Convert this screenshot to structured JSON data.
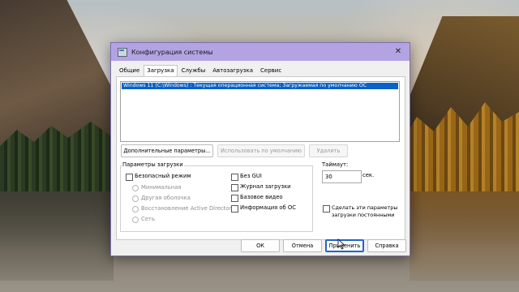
{
  "window": {
    "title": "Конфигурация системы",
    "close_glyph": "✕",
    "app_icon": "system-config-icon"
  },
  "tabs": [
    {
      "label": "Общие",
      "active": false
    },
    {
      "label": "Загрузка",
      "active": true
    },
    {
      "label": "Службы",
      "active": false
    },
    {
      "label": "Автозагрузка",
      "active": false
    },
    {
      "label": "Сервис",
      "active": false
    }
  ],
  "boot_list": {
    "items": [
      "Windows 11 (C:\\Windows) : Текущая операционная система; Загружаемая по умолчанию ОС"
    ]
  },
  "boot_buttons": {
    "advanced": "Дополнительные параметры...",
    "set_default": "Использовать по умолчанию",
    "delete": "Удалить"
  },
  "boot_options": {
    "title": "Параметры загрузки",
    "safe_boot": "Безопасный режим",
    "minimal": "Минимальная",
    "alt_shell": "Другая оболочка",
    "ad_repair": "Восстановление Active Directory",
    "network": "Сеть",
    "no_gui": "Без GUI",
    "boot_log": "Журнал загрузки",
    "base_video": "Базовое видео",
    "os_info": "Информация  об ОС"
  },
  "timeout": {
    "label": "Таймаут:",
    "value": "30",
    "unit": "сек."
  },
  "permanent": {
    "line1": "Сделать эти параметры",
    "line2": "загрузки постоянными"
  },
  "footer": {
    "ok": "ОК",
    "cancel": "Отмена",
    "apply": "Применить",
    "help": "Справка"
  },
  "colors": {
    "titlebar": "#b4a3e3",
    "selection": "#0a62c7",
    "focus_border": "#1f66c7"
  }
}
